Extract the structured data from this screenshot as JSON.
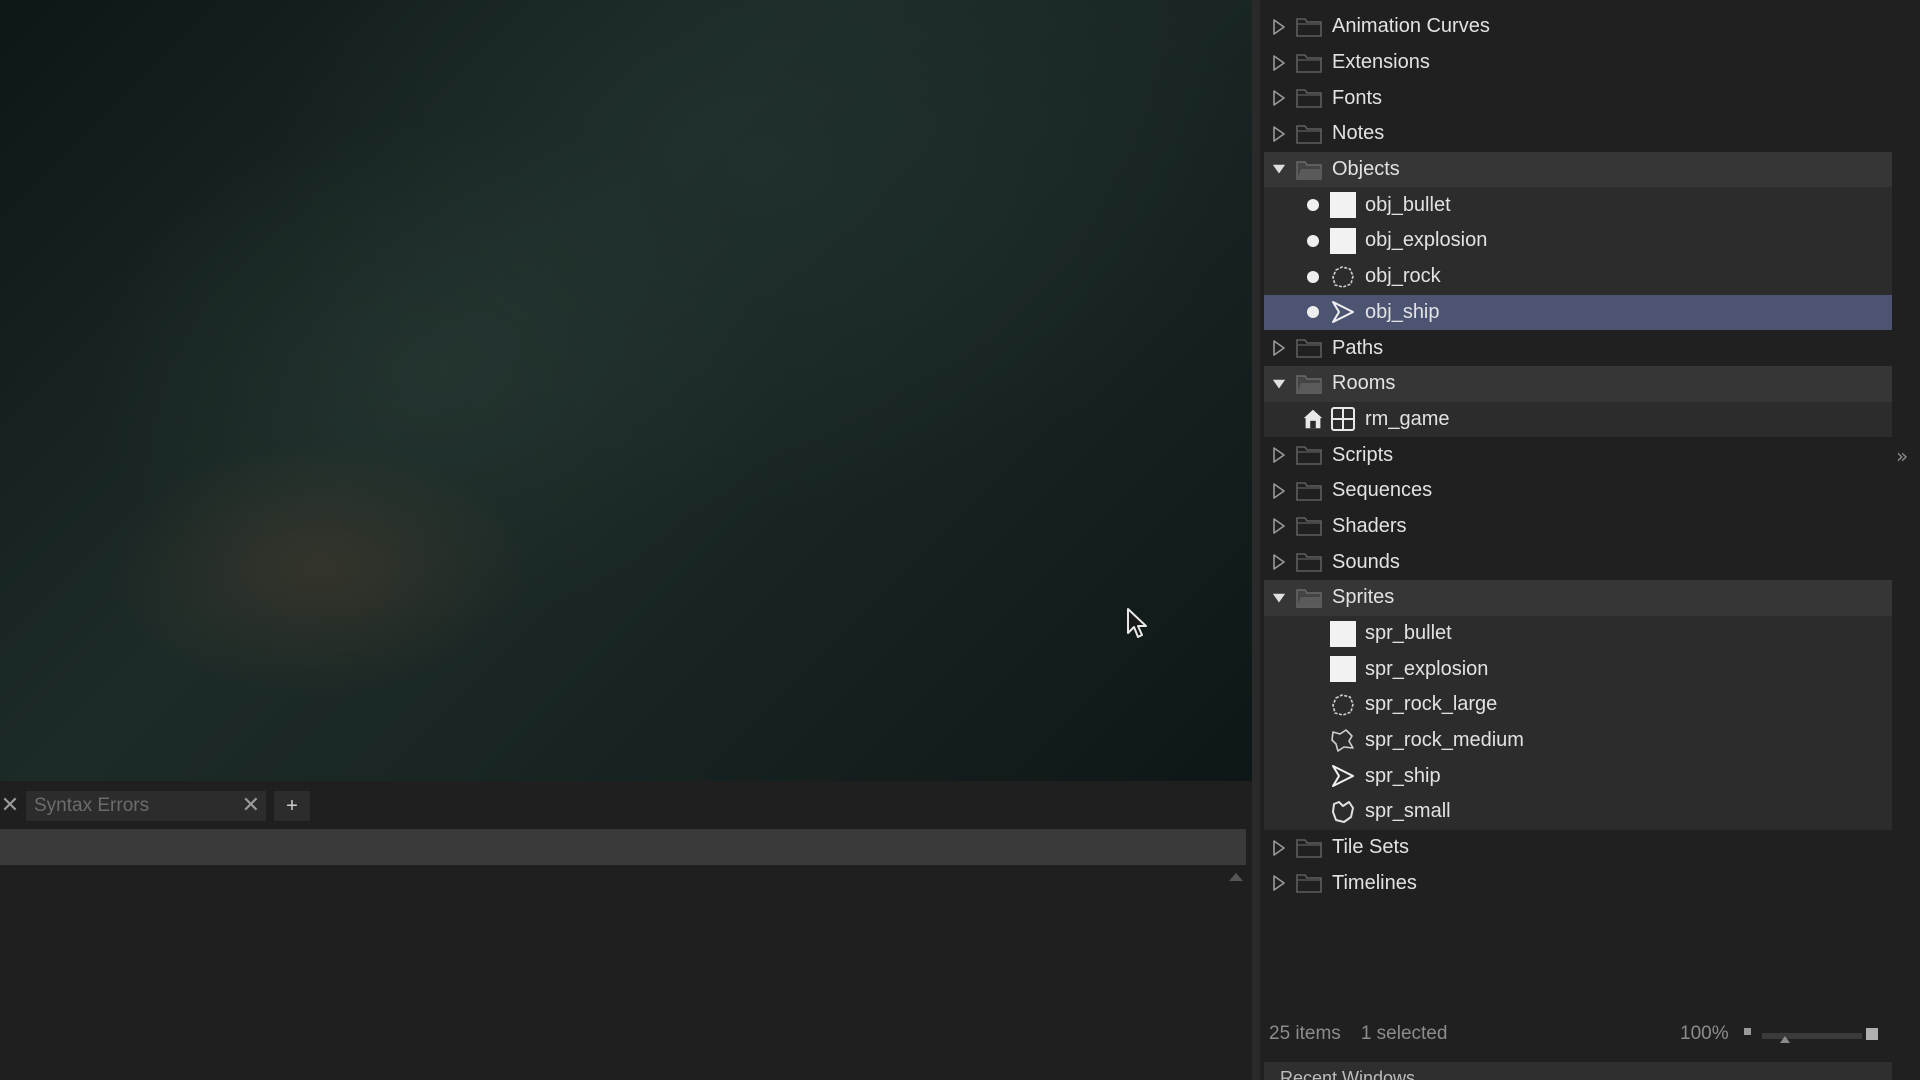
{
  "output_panel": {
    "tab_label": "Syntax Errors",
    "add_tab_label": "+"
  },
  "asset_browser": {
    "tree": [
      {
        "type": "folder",
        "label": "Animation Curves",
        "expanded": false
      },
      {
        "type": "folder",
        "label": "Extensions",
        "expanded": false
      },
      {
        "type": "folder",
        "label": "Fonts",
        "expanded": false
      },
      {
        "type": "folder",
        "label": "Notes",
        "expanded": false
      },
      {
        "type": "folder",
        "label": "Objects",
        "expanded": true
      },
      {
        "type": "object",
        "label": "obj_bullet",
        "icon": "white-square-icon"
      },
      {
        "type": "object",
        "label": "obj_explosion",
        "icon": "white-square-icon"
      },
      {
        "type": "object",
        "label": "obj_rock",
        "icon": "rock-outline-icon"
      },
      {
        "type": "object",
        "label": "obj_ship",
        "icon": "ship-arrow-icon",
        "selected": true
      },
      {
        "type": "folder",
        "label": "Paths",
        "expanded": false
      },
      {
        "type": "folder",
        "label": "Rooms",
        "expanded": true
      },
      {
        "type": "room",
        "label": "rm_game",
        "icon": "room-grid-icon",
        "home": true
      },
      {
        "type": "folder",
        "label": "Scripts",
        "expanded": false
      },
      {
        "type": "folder",
        "label": "Sequences",
        "expanded": false
      },
      {
        "type": "folder",
        "label": "Shaders",
        "expanded": false
      },
      {
        "type": "folder",
        "label": "Sounds",
        "expanded": false
      },
      {
        "type": "folder",
        "label": "Sprites",
        "expanded": true
      },
      {
        "type": "sprite",
        "label": "spr_bullet",
        "icon": "white-square-icon"
      },
      {
        "type": "sprite",
        "label": "spr_explosion",
        "icon": "white-square-icon"
      },
      {
        "type": "sprite",
        "label": "spr_rock_large",
        "icon": "rock-outline-icon"
      },
      {
        "type": "sprite",
        "label": "spr_rock_medium",
        "icon": "rock-medium-icon"
      },
      {
        "type": "sprite",
        "label": "spr_ship",
        "icon": "ship-arrow-icon"
      },
      {
        "type": "sprite",
        "label": "spr_small",
        "icon": "rock-small-icon"
      },
      {
        "type": "folder",
        "label": "Tile Sets",
        "expanded": false
      },
      {
        "type": "folder",
        "label": "Timelines",
        "expanded": false
      }
    ],
    "status": {
      "items": "25 items",
      "selected": "1 selected",
      "zoom": "100%"
    },
    "bottom_panel_label": "Recent Windows"
  },
  "colors": {
    "selection": "#4c5472",
    "panel": "#202020",
    "text": "#e2e2e2"
  }
}
